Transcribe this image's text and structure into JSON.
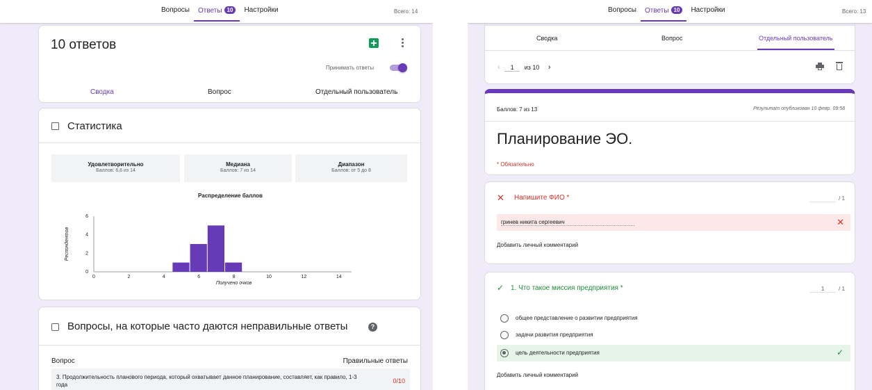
{
  "left": {
    "topbar": {
      "tabs": [
        {
          "label": "Вопросы"
        },
        {
          "label": "Ответы",
          "badge": "10"
        },
        {
          "label": "Настройки"
        }
      ],
      "total": "Всего: 14"
    },
    "header": {
      "title": "10 ответов",
      "accept_label": "Принимать ответы",
      "accept_on": true,
      "subtabs": [
        "Сводка",
        "Вопрос",
        "Отдельный пользователь"
      ]
    },
    "stats": {
      "title": "Статистика",
      "boxes": [
        {
          "title": "Удовлетворительно",
          "value": "Баллов: 6,6 из 14"
        },
        {
          "title": "Медиана",
          "value": "Баллов: 7 из 14"
        },
        {
          "title": "Диапазон",
          "value": "Баллов: от 5 до 8"
        }
      ],
      "dist_title": "Распределение баллов"
    },
    "wrong": {
      "title": "Вопросы, на которые часто даются неправильные ответы",
      "col_question": "Вопрос",
      "col_correct": "Правильные ответы",
      "row": {
        "question": "3. Продолжительность планового периода, который охватывает данное планирование, составляет, как правило, 1-3 года",
        "score": "0/10"
      }
    }
  },
  "right": {
    "topbar": {
      "tabs": [
        {
          "label": "Вопросы"
        },
        {
          "label": "Ответы",
          "badge": "10"
        },
        {
          "label": "Настройки"
        }
      ],
      "total": "Всего: 13"
    },
    "nav": {
      "subtabs": [
        "Сводка",
        "Вопрос",
        "Отдельный пользователь"
      ],
      "current": "1",
      "of_label": "из",
      "of_total": "10"
    },
    "score": {
      "label": "Баллов: 7 из 13",
      "published": "Результат опубликован 10 февр. 09:58",
      "form_title": "Планирование ЭО.",
      "required": "* Обязательно"
    },
    "q1": {
      "title": "Напишите ФИО *",
      "points_suffix": "/ 1",
      "answer": "гринев никита сергеевич",
      "add_comment": "Добавить личный комментарий"
    },
    "q2": {
      "title": "1. Что такое миссия предприятия *",
      "points_value": "1",
      "points_suffix": "/ 1",
      "options": [
        {
          "label": "общее представление о развитии предприятия",
          "selected": false
        },
        {
          "label": "задачи развития предприятия",
          "selected": false
        },
        {
          "label": "цель деятельности предприятия",
          "selected": true
        }
      ],
      "add_comment": "Добавить личный комментарий"
    }
  },
  "colors": {
    "accent": "#673ab7",
    "background": "#f0ebf8",
    "error": "#d93025",
    "success": "#1e8e3e"
  },
  "chart_data": {
    "type": "bar",
    "title": "Распределение баллов",
    "xlabel": "Получено очков",
    "ylabel": "Респондентов",
    "x": [
      5,
      6,
      7,
      8
    ],
    "values": [
      1,
      3,
      5,
      1
    ],
    "xlim": [
      0,
      15
    ],
    "ylim": [
      0,
      6
    ],
    "xticks": [
      0,
      2,
      4,
      6,
      8,
      10,
      12,
      14
    ],
    "yticks": [
      0,
      2,
      4,
      6
    ],
    "color": "#673ab7",
    "grid": false
  }
}
